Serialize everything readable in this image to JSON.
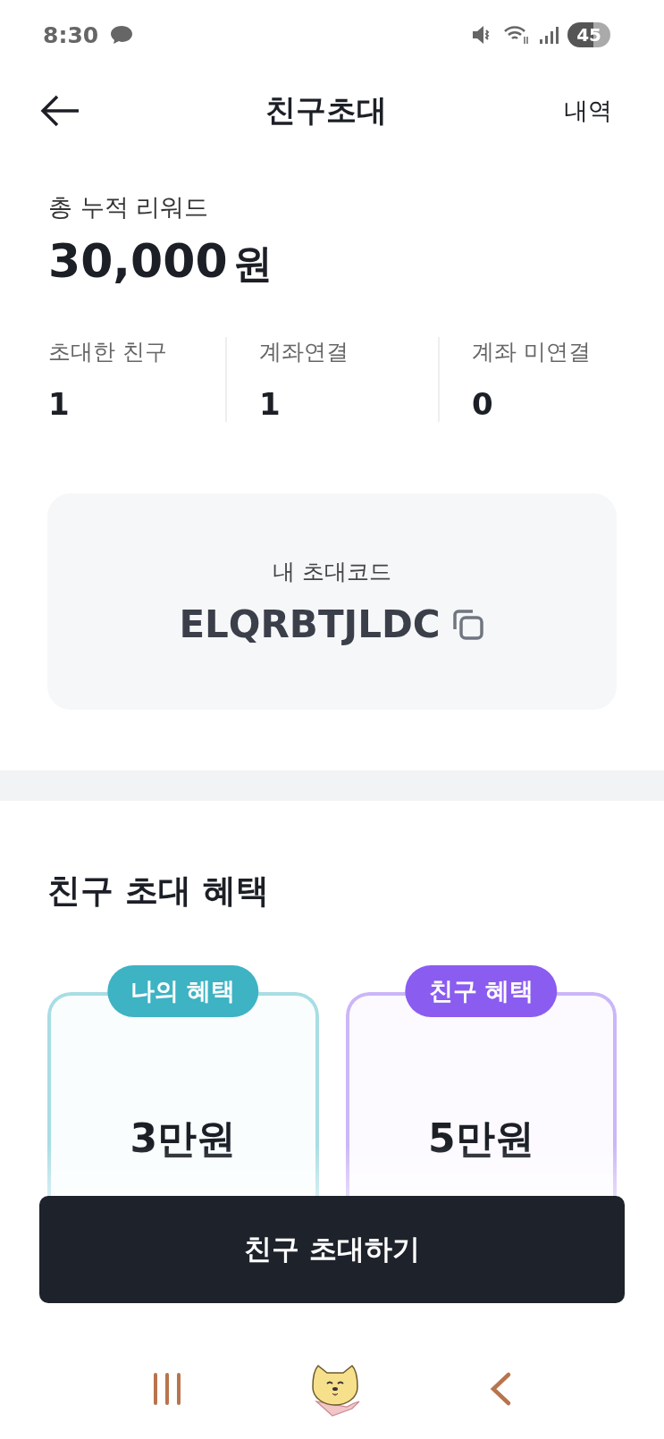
{
  "status_bar": {
    "time": "8:30",
    "battery": "45"
  },
  "header": {
    "title": "친구초대",
    "action": "내역"
  },
  "reward": {
    "label": "총 누적 리워드",
    "amount": "30,000",
    "unit": "원"
  },
  "stats": [
    {
      "label": "초대한 친구",
      "value": "1"
    },
    {
      "label": "계좌연결",
      "value": "1"
    },
    {
      "label": "계좌 미연결",
      "value": "0"
    }
  ],
  "invite_code": {
    "label": "내 초대코드",
    "code": "ELQRBTJLDC"
  },
  "benefits": {
    "title": "친구 초대 혜택",
    "cards": [
      {
        "badge": "나의 혜택",
        "amount": "3만원",
        "color": "#3db3c4"
      },
      {
        "badge": "친구 혜택",
        "amount": "5만원",
        "color": "#8b5cf0"
      }
    ]
  },
  "invite_button": "친구 초대하기"
}
